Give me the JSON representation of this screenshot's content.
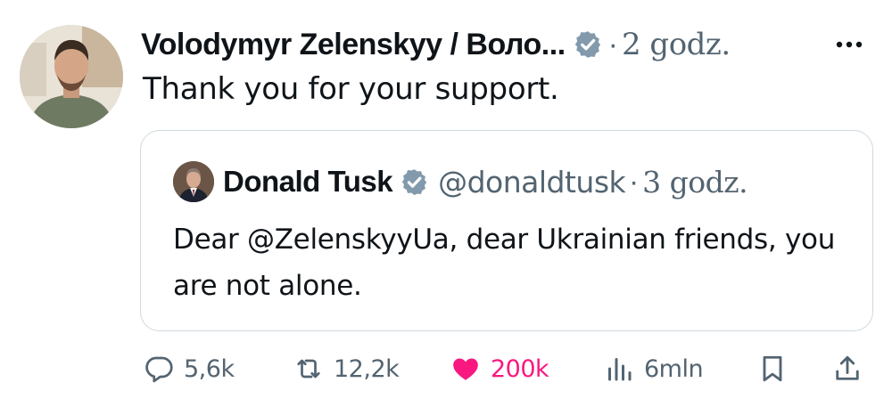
{
  "post": {
    "author_name": "Volodymyr Zelenskyy / Воло...",
    "separator": "·",
    "time": "2 godz.",
    "more_label": "•••",
    "text": "Thank you for your support."
  },
  "quote": {
    "author_name": "Donald Tusk",
    "handle": "@donaldtusk",
    "separator": "·",
    "time": "3 godz.",
    "text": "Dear @ZelenskyyUa, dear Ukrainian friends, you are not alone."
  },
  "actions": {
    "reply_count": "5,6k",
    "repost_count": "12,2k",
    "like_count": "200k",
    "views_count": "6mln"
  },
  "colors": {
    "text": "#0f1419",
    "muted": "#536471",
    "like": "#f91880",
    "verified_badge": "#829aab",
    "border": "#cfd9de"
  },
  "icons": {
    "verified": "verified-badge-icon",
    "more": "more-icon",
    "reply": "comment-icon",
    "repost": "repost-icon",
    "like": "heart-icon",
    "views": "views-icon",
    "bookmark": "bookmark-icon",
    "share": "share-icon"
  }
}
